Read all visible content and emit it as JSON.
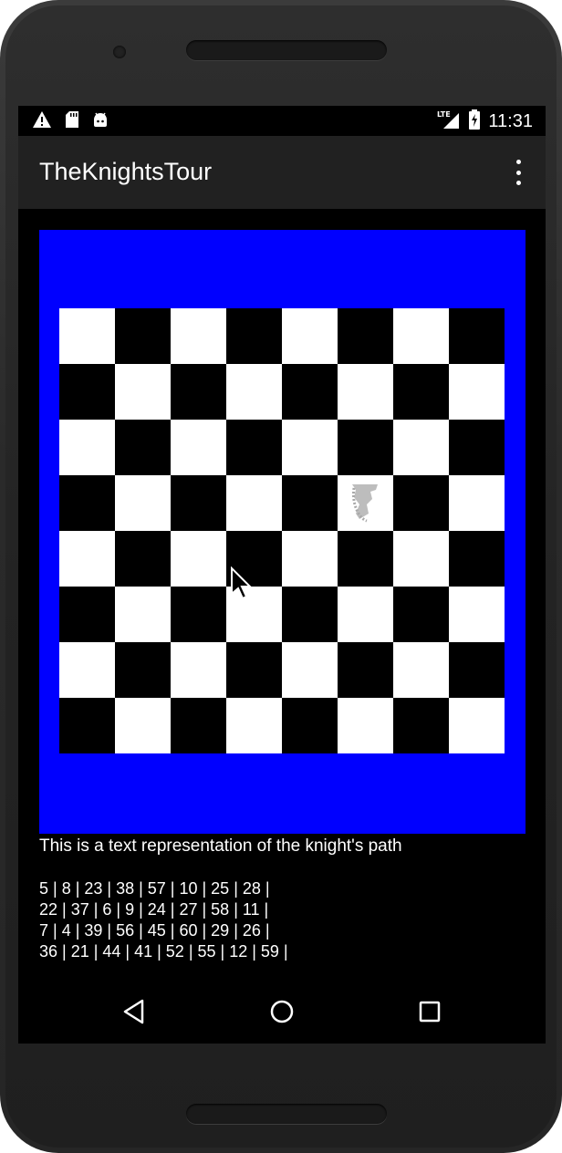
{
  "app": {
    "title": "TheKnightsTour"
  },
  "status_bar": {
    "time": "11:31",
    "icons": [
      "warning-icon",
      "sd-card-icon",
      "android-icon",
      "lte-signal-icon",
      "battery-charging-icon"
    ],
    "network_label": "LTE"
  },
  "board": {
    "size": 8,
    "light_color": "#ffffff",
    "dark_color": "#000000",
    "frame_color": "#0000ff",
    "knight_position": {
      "row": 4,
      "col": 6
    },
    "knight_icon": "knight-piece-icon"
  },
  "path": {
    "caption": "This is a text representation of the knight's path",
    "rows": [
      "5 | 8 | 23 | 38 | 57 | 10 | 25 | 28 |",
      "22 | 37 | 6 | 9 | 24 | 27 | 58 | 11 |",
      "7 | 4 | 39 | 56 | 45 | 60 | 29 | 26 |",
      "36 | 21 | 44 | 41 | 52 | 55 | 12 | 59 |"
    ]
  },
  "navigation": {
    "buttons": [
      "back-icon",
      "home-icon",
      "recents-icon"
    ]
  }
}
